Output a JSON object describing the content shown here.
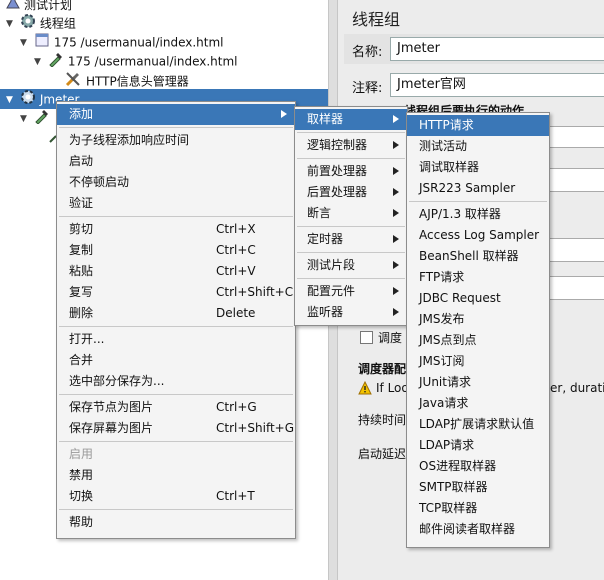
{
  "tree": {
    "items": [
      {
        "label": "测试计划",
        "icon": "beaker-icon"
      },
      {
        "label": "线程组",
        "icon": "gear-icon"
      },
      {
        "label": "175 /usermanual/index.html",
        "icon": "script-icon"
      },
      {
        "label": "175 /usermanual/index.html",
        "icon": "pipette-icon"
      },
      {
        "label": "HTTP信息头管理器",
        "icon": "wrench-icon"
      },
      {
        "label": "Jmeter",
        "icon": "gear-icon"
      }
    ]
  },
  "right": {
    "title": "线程组",
    "name_label": "名称:",
    "name_value": "Jmeter",
    "comment_label": "注释:",
    "comment_value": "Jmeter官网",
    "partial_text": {
      "heading": "线程组后要执行的动作",
      "scheduler_checkbox": "调度",
      "scheduler_config": "调度器配",
      "warning": "If Loo",
      "warning_tail": "er, duration",
      "duration": "持续时间",
      "startup_delay": "启动延迟"
    }
  },
  "context_menu": {
    "items": [
      {
        "label": "添加",
        "shortcut": "",
        "has_sub": true,
        "highlighted": true
      },
      {
        "label": "为子线程添加响应时间",
        "shortcut": ""
      },
      {
        "label": "启动",
        "shortcut": ""
      },
      {
        "label": "不停顿启动",
        "shortcut": ""
      },
      {
        "label": "验证",
        "shortcut": ""
      },
      {
        "label": "剪切",
        "shortcut": "Ctrl+X"
      },
      {
        "label": "复制",
        "shortcut": "Ctrl+C"
      },
      {
        "label": "粘贴",
        "shortcut": "Ctrl+V"
      },
      {
        "label": "复写",
        "shortcut": "Ctrl+Shift+C"
      },
      {
        "label": "删除",
        "shortcut": "Delete"
      },
      {
        "label": "打开...",
        "shortcut": ""
      },
      {
        "label": "合并",
        "shortcut": ""
      },
      {
        "label": "选中部分保存为...",
        "shortcut": ""
      },
      {
        "label": "保存节点为图片",
        "shortcut": "Ctrl+G"
      },
      {
        "label": "保存屏幕为图片",
        "shortcut": "Ctrl+Shift+G"
      },
      {
        "label": "启用",
        "shortcut": "",
        "disabled": true
      },
      {
        "label": "禁用",
        "shortcut": ""
      },
      {
        "label": "切换",
        "shortcut": "Ctrl+T"
      },
      {
        "label": "帮助",
        "shortcut": ""
      }
    ]
  },
  "add_submenu": {
    "items": [
      {
        "label": "取样器",
        "highlighted": true
      },
      {
        "label": "逻辑控制器"
      },
      {
        "label": "前置处理器"
      },
      {
        "label": "后置处理器"
      },
      {
        "label": "断言"
      },
      {
        "label": "定时器"
      },
      {
        "label": "测试片段"
      },
      {
        "label": "配置元件"
      },
      {
        "label": "监听器"
      }
    ]
  },
  "sampler_submenu": {
    "items": [
      {
        "label": "HTTP请求",
        "highlighted": true
      },
      {
        "label": "测试活动"
      },
      {
        "label": "调试取样器"
      },
      {
        "label": "JSR223 Sampler"
      },
      {
        "label": "AJP/1.3 取样器"
      },
      {
        "label": "Access Log Sampler"
      },
      {
        "label": "BeanShell 取样器"
      },
      {
        "label": "FTP请求"
      },
      {
        "label": "JDBC Request"
      },
      {
        "label": "JMS发布"
      },
      {
        "label": "JMS点到点"
      },
      {
        "label": "JMS订阅"
      },
      {
        "label": "JUnit请求"
      },
      {
        "label": "Java请求"
      },
      {
        "label": "LDAP扩展请求默认值"
      },
      {
        "label": "LDAP请求"
      },
      {
        "label": "OS进程取样器"
      },
      {
        "label": "SMTP取样器"
      },
      {
        "label": "TCP取样器"
      },
      {
        "label": "邮件阅读者取样器"
      }
    ]
  },
  "colors": {
    "highlight": "#3a77b7",
    "menu_bg": "#f4f4f4",
    "window_bg": "#ececec"
  }
}
